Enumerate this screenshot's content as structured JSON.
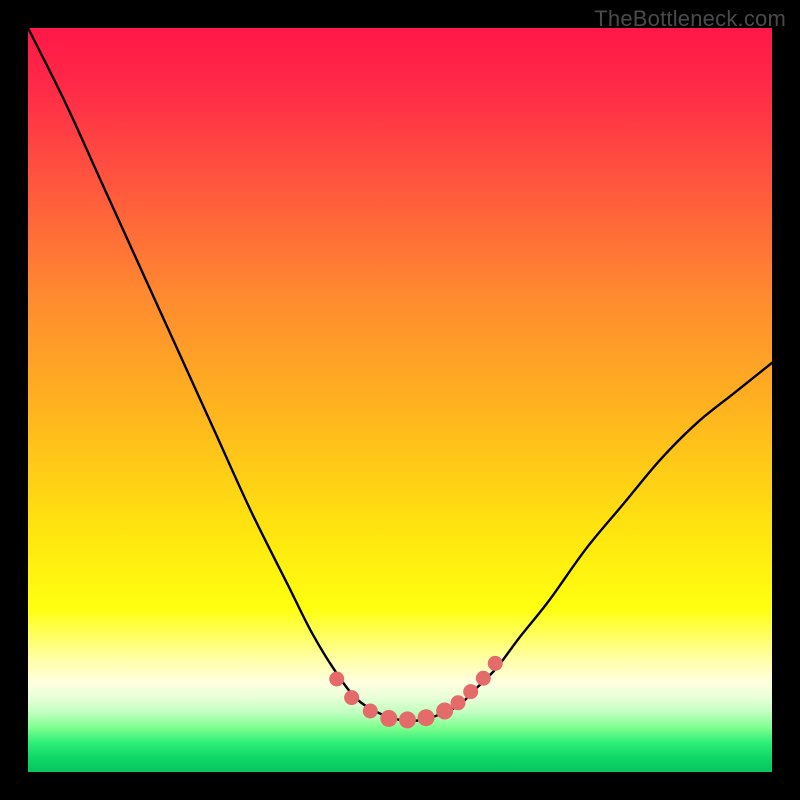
{
  "watermark": "TheBottleneck.com",
  "chart_data": {
    "type": "line",
    "title": "",
    "xlabel": "",
    "ylabel": "",
    "xlim": [
      0,
      100
    ],
    "ylim": [
      0,
      100
    ],
    "grid": false,
    "legend": false,
    "notes": "V-shaped bottleneck curve over heatmap-style vertical gradient (red top → green bottom). Minimum sits around x≈47–55 at y≈6–8. Left branch rises to top-left corner; right branch exits right edge near y≈55.",
    "series": [
      {
        "name": "curve",
        "x": [
          0,
          5,
          10,
          15,
          20,
          25,
          30,
          35,
          38,
          41,
          44,
          47,
          50,
          53,
          56,
          58,
          60,
          63,
          66,
          70,
          75,
          80,
          85,
          90,
          95,
          100
        ],
        "y": [
          100,
          90,
          79,
          68,
          57,
          46,
          35,
          25,
          19,
          14,
          10,
          8,
          7,
          7,
          8,
          9,
          11,
          14,
          18,
          23,
          30,
          36,
          42,
          47,
          51,
          55
        ]
      }
    ],
    "markers": {
      "name": "highlight-dots",
      "color": "#e56a6a",
      "x": [
        41.5,
        43.5,
        46.0,
        48.5,
        51.0,
        53.5,
        56.0,
        57.8,
        59.5,
        61.2,
        62.8
      ],
      "y": [
        12.5,
        10.0,
        8.2,
        7.2,
        7.0,
        7.3,
        8.2,
        9.3,
        10.8,
        12.6,
        14.6
      ]
    },
    "gradient_stops": [
      {
        "pct": 0,
        "color": "#ff1848"
      },
      {
        "pct": 22,
        "color": "#ff5a3d"
      },
      {
        "pct": 52,
        "color": "#ffb61e"
      },
      {
        "pct": 78,
        "color": "#ffff10"
      },
      {
        "pct": 88,
        "color": "#ffffe0"
      },
      {
        "pct": 94,
        "color": "#80ff90"
      },
      {
        "pct": 100,
        "color": "#07c65e"
      }
    ]
  }
}
